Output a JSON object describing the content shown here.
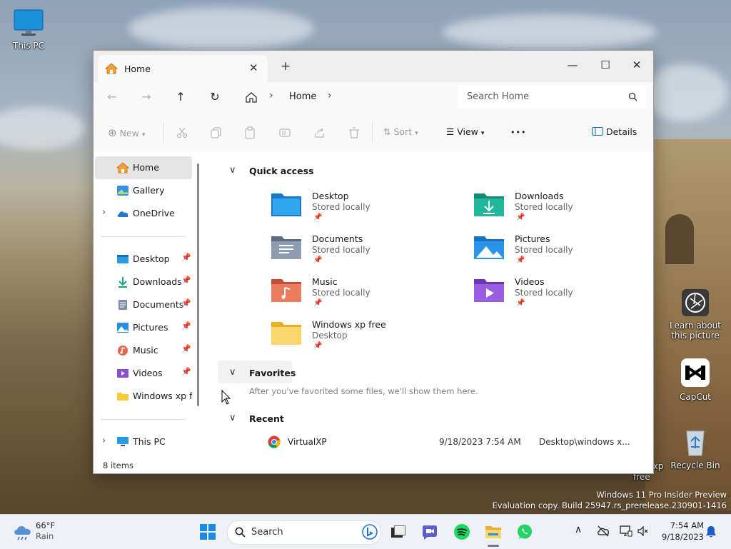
{
  "desktop": {
    "icons": {
      "this_pc": "This PC",
      "learn": "Learn about this picture",
      "capcut": "CapCut",
      "recycle_bin": "Recycle Bin",
      "hidden_xp": "xp",
      "hidden_free": "free"
    },
    "watermark": {
      "line1": "Windows 11 Pro Insider Preview",
      "line2": "Evaluation copy. Build 25947.rs_prerelease.230901-1416"
    }
  },
  "window": {
    "tab": {
      "title": "Home"
    },
    "controls": {
      "minimize": "—",
      "maximize": "☐",
      "close": "✕",
      "new_tab": "+"
    },
    "address": {
      "crumb": "Home",
      "search_placeholder": "Search Home"
    },
    "command_bar": {
      "new_label": "New",
      "sort_label": "Sort",
      "view_label": "View",
      "more_label": "•••",
      "details_label": "Details"
    },
    "nav_pane": {
      "home": "Home",
      "gallery": "Gallery",
      "onedrive": "OneDrive",
      "pinned": [
        "Desktop",
        "Downloads",
        "Documents",
        "Pictures",
        "Music",
        "Videos",
        "Windows xp free"
      ],
      "this_pc": "This PC"
    },
    "content": {
      "quick_access_title": "Quick access",
      "quick_access": [
        {
          "name": "Desktop",
          "sub": "Stored locally"
        },
        {
          "name": "Downloads",
          "sub": "Stored locally"
        },
        {
          "name": "Documents",
          "sub": "Stored locally"
        },
        {
          "name": "Pictures",
          "sub": "Stored locally"
        },
        {
          "name": "Music",
          "sub": "Stored locally"
        },
        {
          "name": "Videos",
          "sub": "Stored locally"
        },
        {
          "name": "Windows xp free",
          "sub": "Desktop"
        }
      ],
      "favorites_title": "Favorites",
      "favorites_hint": "After you've favorited some files, we'll show them here.",
      "recent_title": "Recent",
      "recent": [
        {
          "name": "VirtualXP",
          "date": "9/18/2023 7:54 AM",
          "location": "Desktop\\windows x..."
        }
      ]
    },
    "status": {
      "items": "8 items"
    }
  },
  "taskbar": {
    "weather": {
      "temp": "66°F",
      "desc": "Rain"
    },
    "search_placeholder": "Search",
    "clock": {
      "time": "7:54 AM",
      "date": "9/18/2023"
    }
  },
  "colors": {
    "accent": "#0067c0",
    "folder_yellow": "#f8c93a",
    "downloads_teal": "#17a589",
    "music_orange": "#e2674c",
    "videos_purple": "#8a4fd0"
  }
}
